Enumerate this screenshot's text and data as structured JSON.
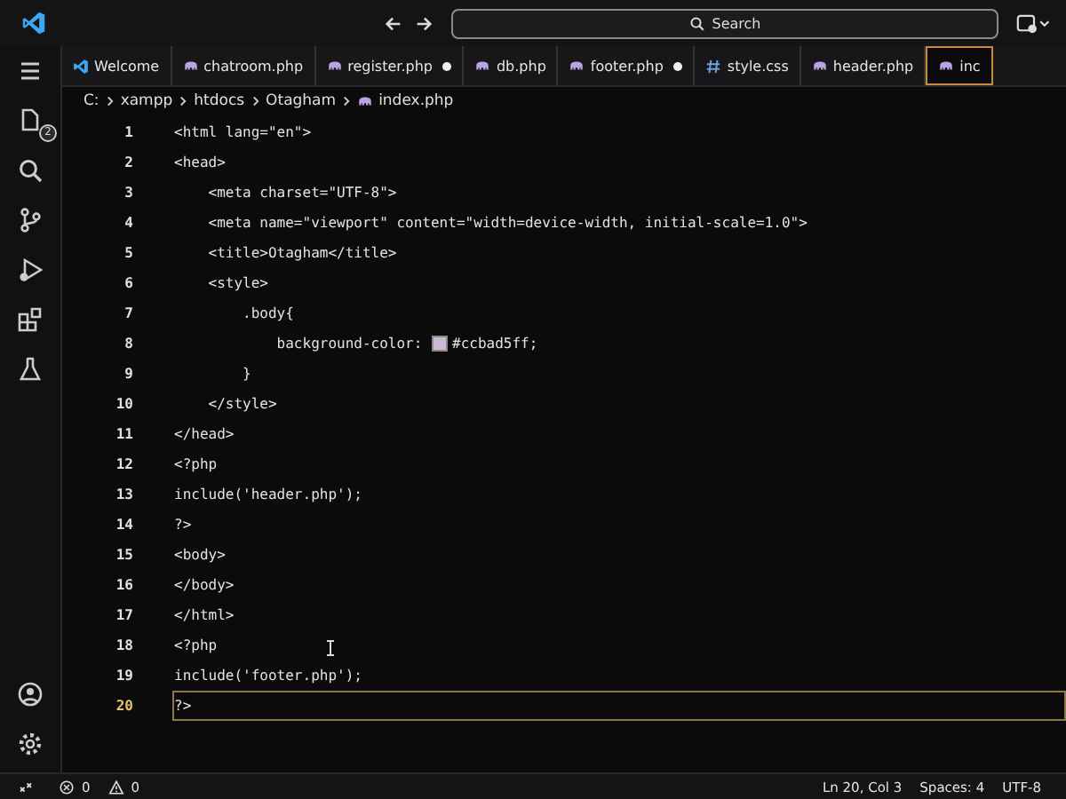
{
  "title_bar": {
    "search": {
      "placeholder": "Search"
    }
  },
  "activity_bar": {
    "explorer_badge": "2"
  },
  "tabs": [
    {
      "label": "Welcome",
      "modified": false,
      "selected": false
    },
    {
      "label": "chatroom.php",
      "modified": false,
      "selected": false
    },
    {
      "label": "register.php",
      "modified": true,
      "selected": false
    },
    {
      "label": "db.php",
      "modified": false,
      "selected": false
    },
    {
      "label": "footer.php",
      "modified": true,
      "selected": false
    },
    {
      "label": "style.css",
      "modified": false,
      "selected": false
    },
    {
      "label": "header.php",
      "modified": false,
      "selected": false
    },
    {
      "label": "inc",
      "modified": false,
      "selected": true
    }
  ],
  "breadcrumb": [
    "C:",
    "xampp",
    "htdocs",
    "Otagham",
    "index.php"
  ],
  "editor": {
    "lines": [
      {
        "number": "1",
        "current": false,
        "text": "<html lang=\"en\">"
      },
      {
        "number": "2",
        "current": false,
        "text": "<head>"
      },
      {
        "number": "3",
        "current": false,
        "text": "    <meta charset=\"UTF-8\">"
      },
      {
        "number": "4",
        "current": false,
        "text": "    <meta name=\"viewport\" content=\"width=device-width, initial-scale=1.0\">"
      },
      {
        "number": "5",
        "current": false,
        "text": "    <title>Otagham</title>"
      },
      {
        "number": "6",
        "current": false,
        "text": "    <style>"
      },
      {
        "number": "7",
        "current": false,
        "text": "        .body{"
      },
      {
        "number": "8",
        "current": false,
        "text": "            background-color: ",
        "color": "#ccbad5",
        "text_after": "#ccbad5ff;"
      },
      {
        "number": "9",
        "current": false,
        "text": "        }"
      },
      {
        "number": "10",
        "current": false,
        "text": "    </style>"
      },
      {
        "number": "11",
        "current": false,
        "text": "</head>"
      },
      {
        "number": "12",
        "current": false,
        "text": "<?php"
      },
      {
        "number": "13",
        "current": false,
        "text": "include('header.php');"
      },
      {
        "number": "14",
        "current": false,
        "text": "?>"
      },
      {
        "number": "15",
        "current": false,
        "text": "<body>"
      },
      {
        "number": "16",
        "current": false,
        "text": "</body>"
      },
      {
        "number": "17",
        "current": false,
        "text": "</html>"
      },
      {
        "number": "18",
        "current": false,
        "text": "<?php"
      },
      {
        "number": "19",
        "current": false,
        "text": "include('footer.php');"
      },
      {
        "number": "20",
        "current": true,
        "text": "?>"
      }
    ]
  },
  "status_bar": {
    "errors": "0",
    "warnings": "0",
    "position": "Ln 20, Col 3",
    "indent": "Spaces: 4",
    "encoding": "UTF-8"
  }
}
